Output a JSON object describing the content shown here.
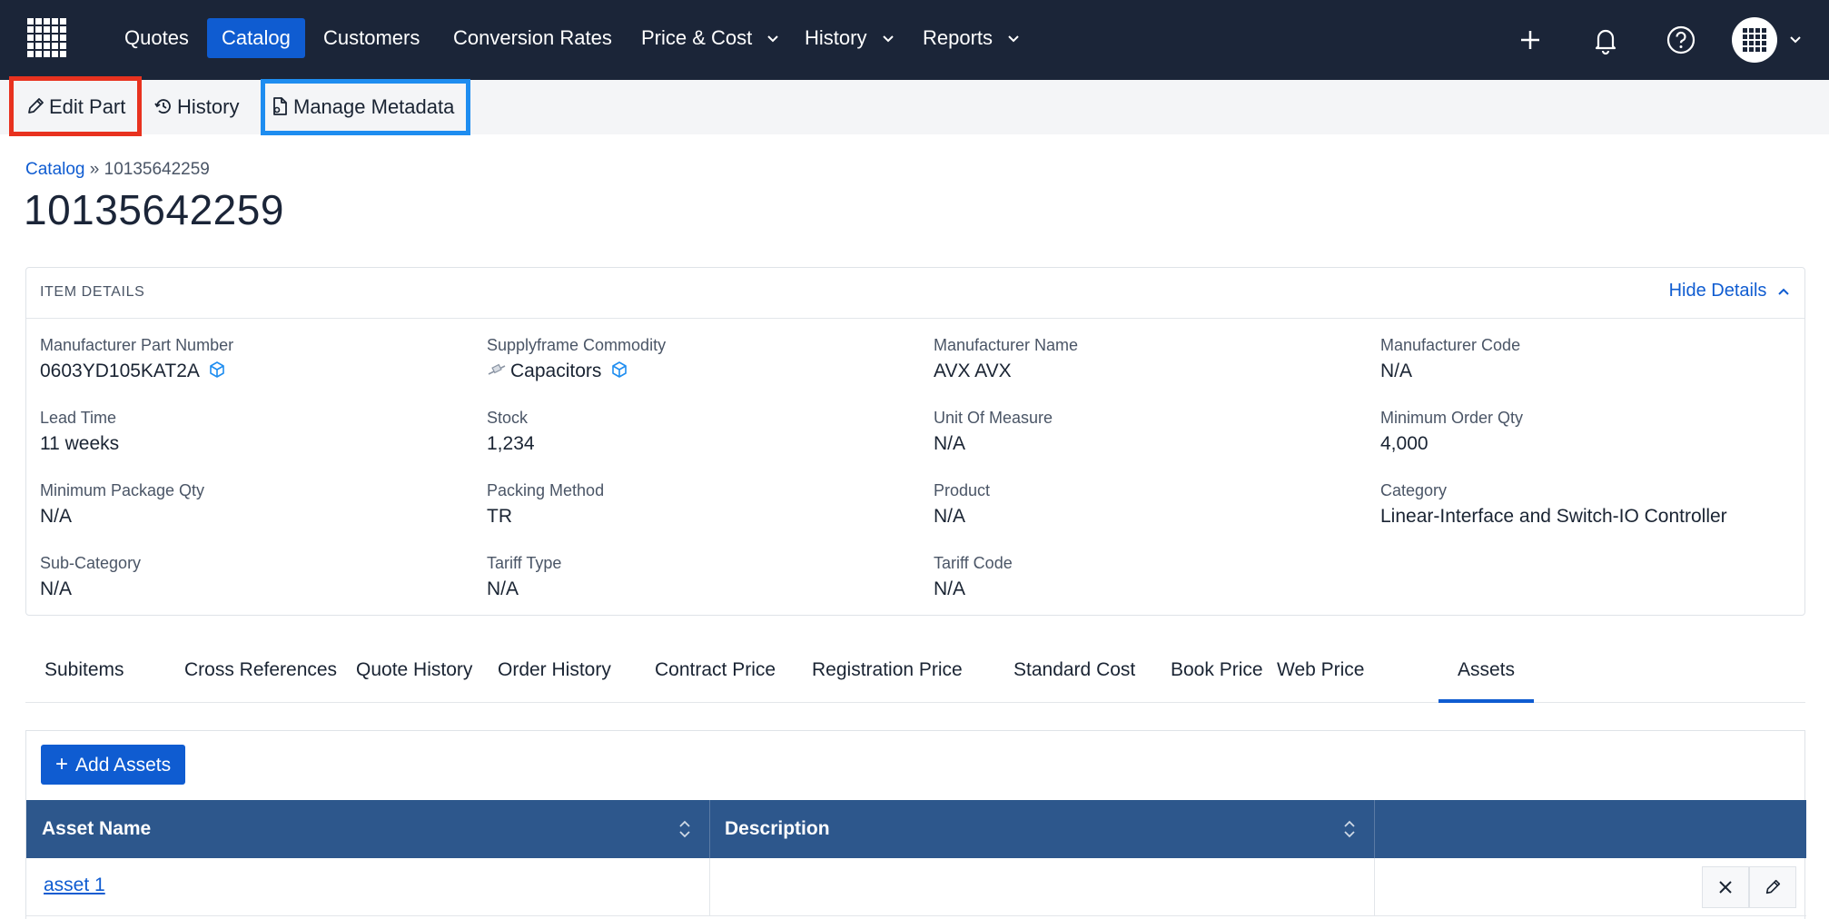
{
  "nav": {
    "items": [
      "Quotes",
      "Catalog",
      "Customers",
      "Conversion Rates",
      "Price & Cost",
      "History",
      "Reports"
    ],
    "active": "Catalog",
    "brand_color": "#1b2538",
    "accent_color": "#0f5cd1"
  },
  "toolbar": {
    "edit_part": "Edit Part",
    "history": "History",
    "manage_metadata": "Manage Metadata",
    "highlight_red": "#e8321f",
    "highlight_blue": "#1e8df0"
  },
  "breadcrumb": {
    "root": "Catalog",
    "separator": "»",
    "current": "10135642259"
  },
  "page_title": "10135642259",
  "details": {
    "title": "ITEM DETAILS",
    "toggle": "Hide Details",
    "fields": [
      {
        "label": "Manufacturer Part Number",
        "value": "0603YD105KAT2A"
      },
      {
        "label": "Supplyframe Commodity",
        "value": "Capacitors"
      },
      {
        "label": "Manufacturer Name",
        "value": "AVX AVX"
      },
      {
        "label": "Manufacturer Code",
        "value": "N/A"
      },
      {
        "label": "Lead Time",
        "value": "11 weeks"
      },
      {
        "label": "Stock",
        "value": "1,234"
      },
      {
        "label": "Unit Of Measure",
        "value": "N/A"
      },
      {
        "label": "Minimum Order Qty",
        "value": "4,000"
      },
      {
        "label": "Minimum Package Qty",
        "value": "N/A"
      },
      {
        "label": "Packing Method",
        "value": "TR"
      },
      {
        "label": "Product",
        "value": "N/A"
      },
      {
        "label": "Category",
        "value": "Linear-Interface and Switch-IO Controller"
      },
      {
        "label": "Sub-Category",
        "value": "N/A"
      },
      {
        "label": "Tariff Type",
        "value": "N/A"
      },
      {
        "label": "Tariff Code",
        "value": "N/A"
      }
    ]
  },
  "tabs": [
    "Subitems",
    "Cross References",
    "Quote History",
    "Order History",
    "Contract Price",
    "Registration Price",
    "Standard Cost",
    "Book Price",
    "Web Price",
    "Assets"
  ],
  "active_tab": "Assets",
  "assets": {
    "add_button": "Add Assets",
    "columns": [
      "Asset Name",
      "Description"
    ],
    "rows": [
      {
        "name": "asset 1",
        "description": ""
      }
    ],
    "header_color": "#2d578c"
  }
}
